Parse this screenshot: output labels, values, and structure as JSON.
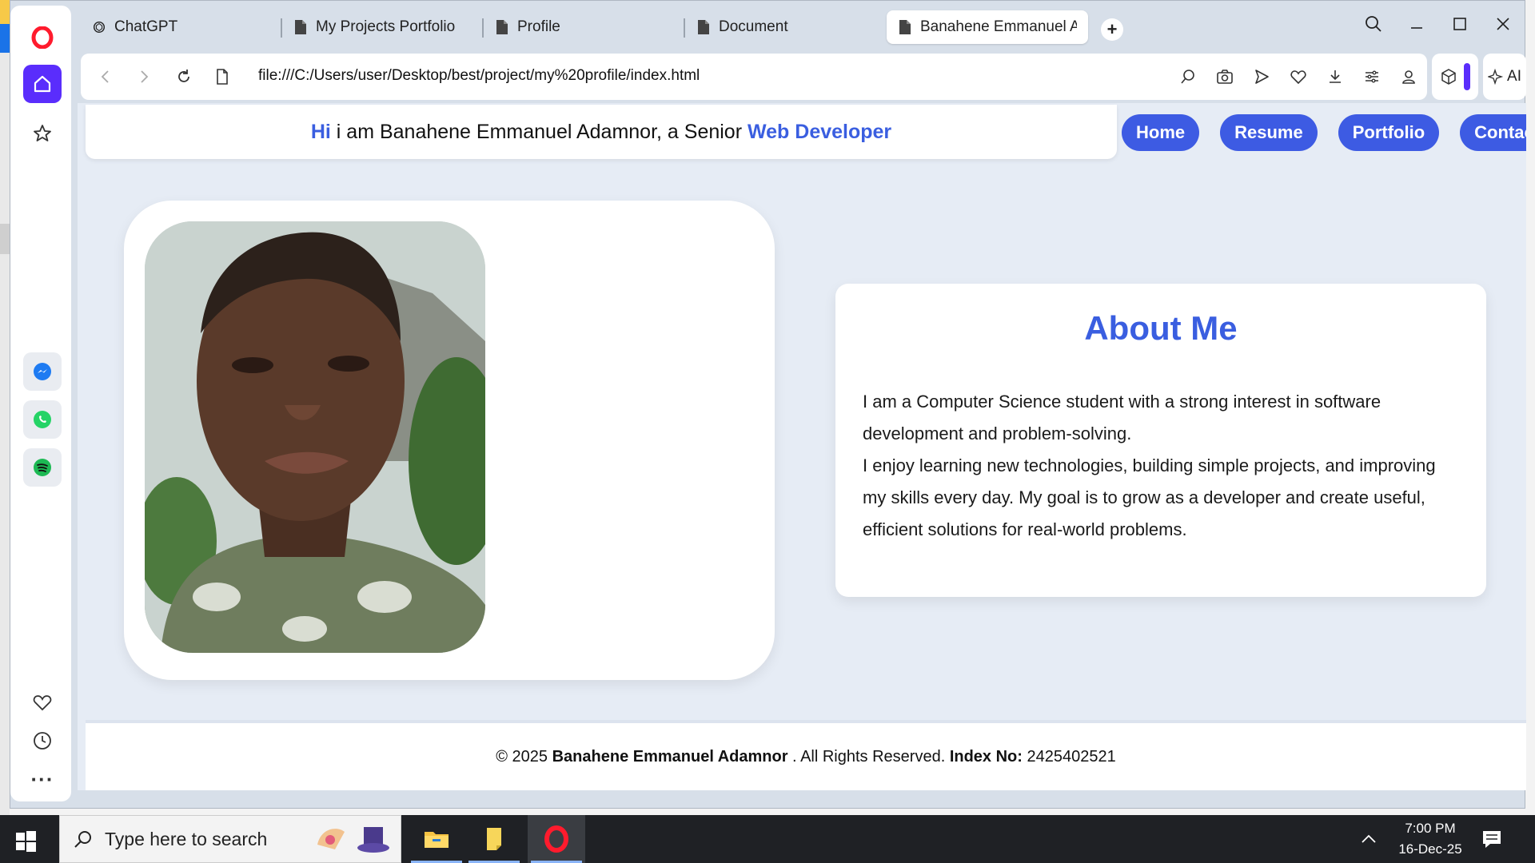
{
  "browser": {
    "tabs": [
      {
        "label": "ChatGPT",
        "icon": "chatgpt-icon"
      },
      {
        "label": "My Projects Portfolio",
        "icon": "document-icon"
      },
      {
        "label": "Profile",
        "icon": "document-icon"
      },
      {
        "label": "Document",
        "icon": "document-icon"
      },
      {
        "label": "Banahene Emmanuel Adar",
        "icon": "document-icon",
        "active": true
      }
    ],
    "url": "file:///C:/Users/user/Desktop/best/project/my%20profile/index.html",
    "ai_label": "AI",
    "accent_color": "#5a2dfc"
  },
  "page": {
    "header": {
      "hi": "Hi",
      "middle": " i am Banahene Emmanuel Adamnor, a Senior ",
      "role": "Web Developer"
    },
    "nav": [
      "Home",
      "Resume",
      "Portfolio",
      "Contact"
    ],
    "about": {
      "title": "About Me",
      "paragraph1": "I am a Computer Science student with a strong interest in software development and problem-solving.",
      "paragraph2": "I enjoy learning new technologies, building simple projects, and improving my skills every day. My goal is to grow as a developer and create useful, efficient solutions for real-world problems."
    },
    "footer": {
      "prefix": "© 2025 ",
      "name": "Banahene Emmanuel Adamnor",
      "middle": " . All Rights Reserved. ",
      "index_label": "Index No:",
      "index_value": " 2425402521"
    },
    "accent_color": "#3d5be3"
  },
  "taskbar": {
    "search_placeholder": "Type here to search",
    "time": "7:00 PM",
    "date": "16-Dec-25"
  }
}
